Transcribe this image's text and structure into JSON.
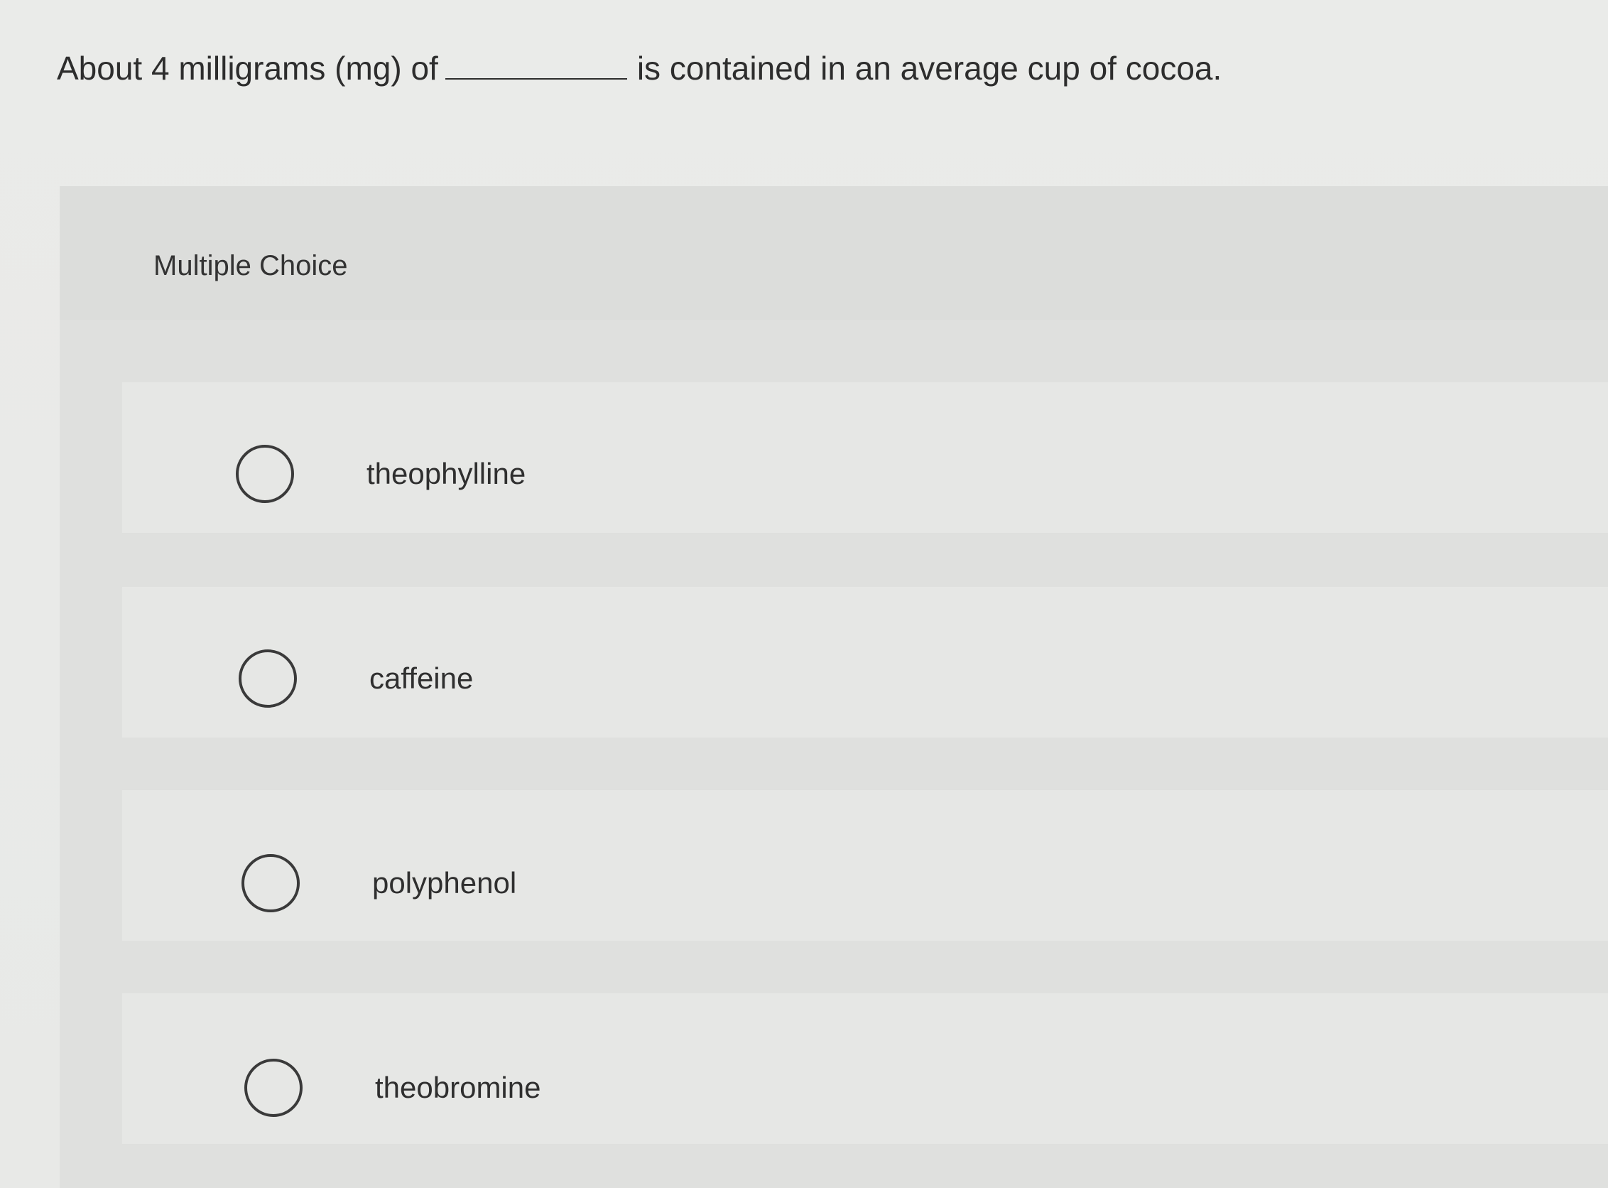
{
  "question": {
    "prefix": "About 4 milligrams (mg) of",
    "suffix": "is contained in an average cup of cocoa."
  },
  "multiple_choice": {
    "title": "Multiple Choice",
    "options": [
      {
        "label": "theophylline",
        "selected": false
      },
      {
        "label": "caffeine",
        "selected": false
      },
      {
        "label": "polyphenol",
        "selected": false
      },
      {
        "label": "theobromine",
        "selected": false
      }
    ]
  }
}
